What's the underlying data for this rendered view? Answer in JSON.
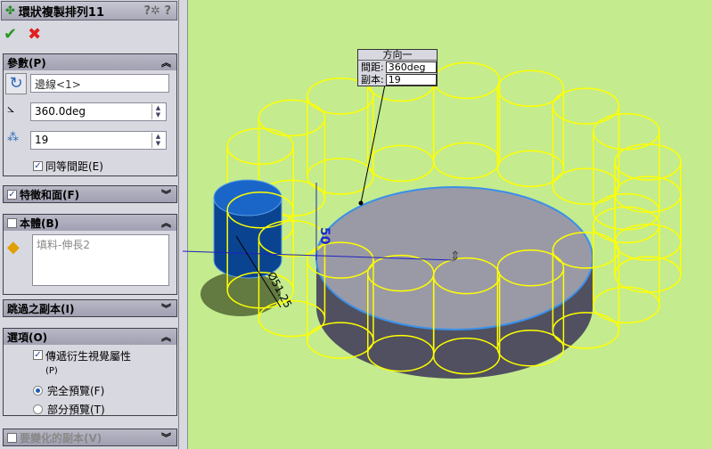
{
  "title": "環狀複製排列11",
  "icons": {
    "feature": "circular-pattern-icon",
    "help": "help-icon",
    "ok": "check-icon",
    "cancel": "x-icon"
  },
  "colors": {
    "viewport": "#c4eb8e",
    "pattern_preview": "#ffff00",
    "seed_body": "#1560c0",
    "panel": "#d8d8e0"
  },
  "sections": {
    "parameters": {
      "label": "參數(P)",
      "axis": "邊線<1>",
      "angle": "360.0deg",
      "count": "19",
      "equal_spacing": "同等間距(E)",
      "equal_spacing_checked": true
    },
    "features_faces": {
      "label": "特徵和面(F)",
      "checked": true
    },
    "bodies": {
      "label": "本體(B)",
      "checked": false,
      "item": "填料-伸長2"
    },
    "skip_instances": {
      "label": "跳過之副本(I)"
    },
    "options": {
      "label": "選項(O)",
      "propagate": "傳遞衍生視覺屬性",
      "propagate_suffix": "(P)",
      "propagate_checked": true,
      "full_preview": "完全預覽(F)",
      "partial_preview": "部分預覽(T)",
      "selected": "full"
    },
    "vary_instances": {
      "label": "要變化的副本(V)",
      "checked": false
    }
  },
  "callout": {
    "title": "方向一",
    "spacing_label": "間距:",
    "spacing": "360deg",
    "count_label": "副本:",
    "count": "19"
  },
  "dimensions": {
    "height": "50",
    "diameter": "Ø51.25"
  }
}
